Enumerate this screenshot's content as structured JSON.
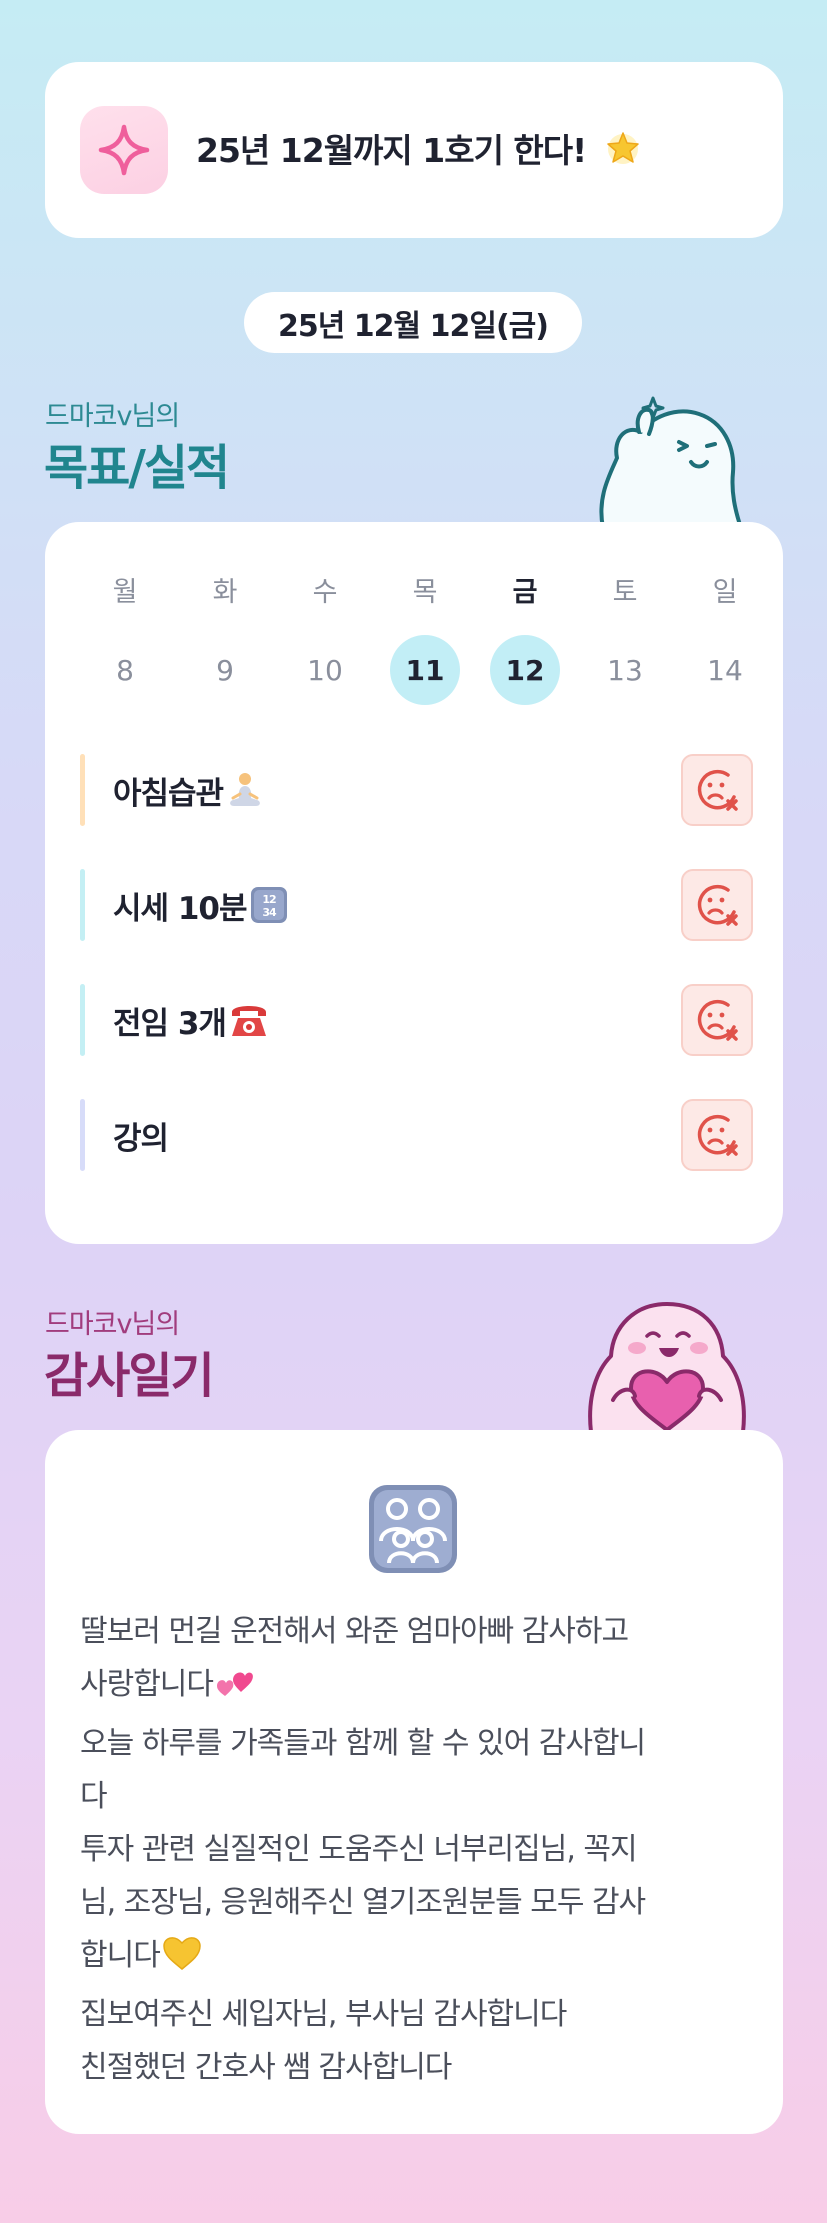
{
  "goal_banner": {
    "text": "25년 12월까지 1호기 한다!",
    "icon": "sparkle-icon",
    "trailing_icon": "glowing-star-icon"
  },
  "date_pill": {
    "text": "25년 12월 12일(금)"
  },
  "goals_section": {
    "subtitle": "드마코v님의",
    "title": "목표/실적",
    "accent_color": "#20858e"
  },
  "week": {
    "days": [
      {
        "name": "월",
        "num": "8",
        "marked": false,
        "active": false
      },
      {
        "name": "화",
        "num": "9",
        "marked": false,
        "active": false
      },
      {
        "name": "수",
        "num": "10",
        "marked": false,
        "active": false
      },
      {
        "name": "목",
        "num": "11",
        "marked": true,
        "active": false
      },
      {
        "name": "금",
        "num": "12",
        "marked": true,
        "active": true
      },
      {
        "name": "토",
        "num": "13",
        "marked": false,
        "active": false
      },
      {
        "name": "일",
        "num": "14",
        "marked": false,
        "active": false
      }
    ],
    "marked_color": "#c2eef6"
  },
  "goals": [
    {
      "label": "아침습관",
      "emoji": "meditation-icon",
      "bar_color": "#ffe0b8",
      "status": "not-done"
    },
    {
      "label": "시세 10분",
      "emoji": "input-numbers-icon",
      "bar_color": "#c4eff4",
      "status": "not-done"
    },
    {
      "label": "전임 3개",
      "emoji": "telephone-icon",
      "bar_color": "#c4eff4",
      "status": "not-done"
    },
    {
      "label": "강의",
      "emoji": "",
      "bar_color": "#d7dcf9",
      "status": "not-done"
    }
  ],
  "thanks_section": {
    "subtitle": "드마코v님의",
    "title": "감사일기",
    "accent_color": "#8a2a6a",
    "emoji": "family-icon",
    "lines": [
      {
        "text": "딸보러 먼길 운전해서 와준 엄마아빠 감사하고",
        "emoji": ""
      },
      {
        "text": "사랑합니다",
        "emoji": "two-hearts-icon"
      },
      {
        "text": "오늘 하루를 가족들과 함께 할 수 있어 감사합니",
        "emoji": ""
      },
      {
        "text": "다",
        "emoji": ""
      },
      {
        "text": "투자 관련 실질적인 도움주신 너부리집님, 꼭지",
        "emoji": ""
      },
      {
        "text": "님, 조장님, 응원해주신 열기조원분들 모두 감사",
        "emoji": ""
      },
      {
        "text": "합니다",
        "emoji": "yellow-heart-icon"
      },
      {
        "text": "집보여주신 세입자님, 부사님 감사합니다",
        "emoji": ""
      },
      {
        "text": "친절했던 간호사 쌤 감사합니다",
        "emoji": ""
      }
    ]
  }
}
